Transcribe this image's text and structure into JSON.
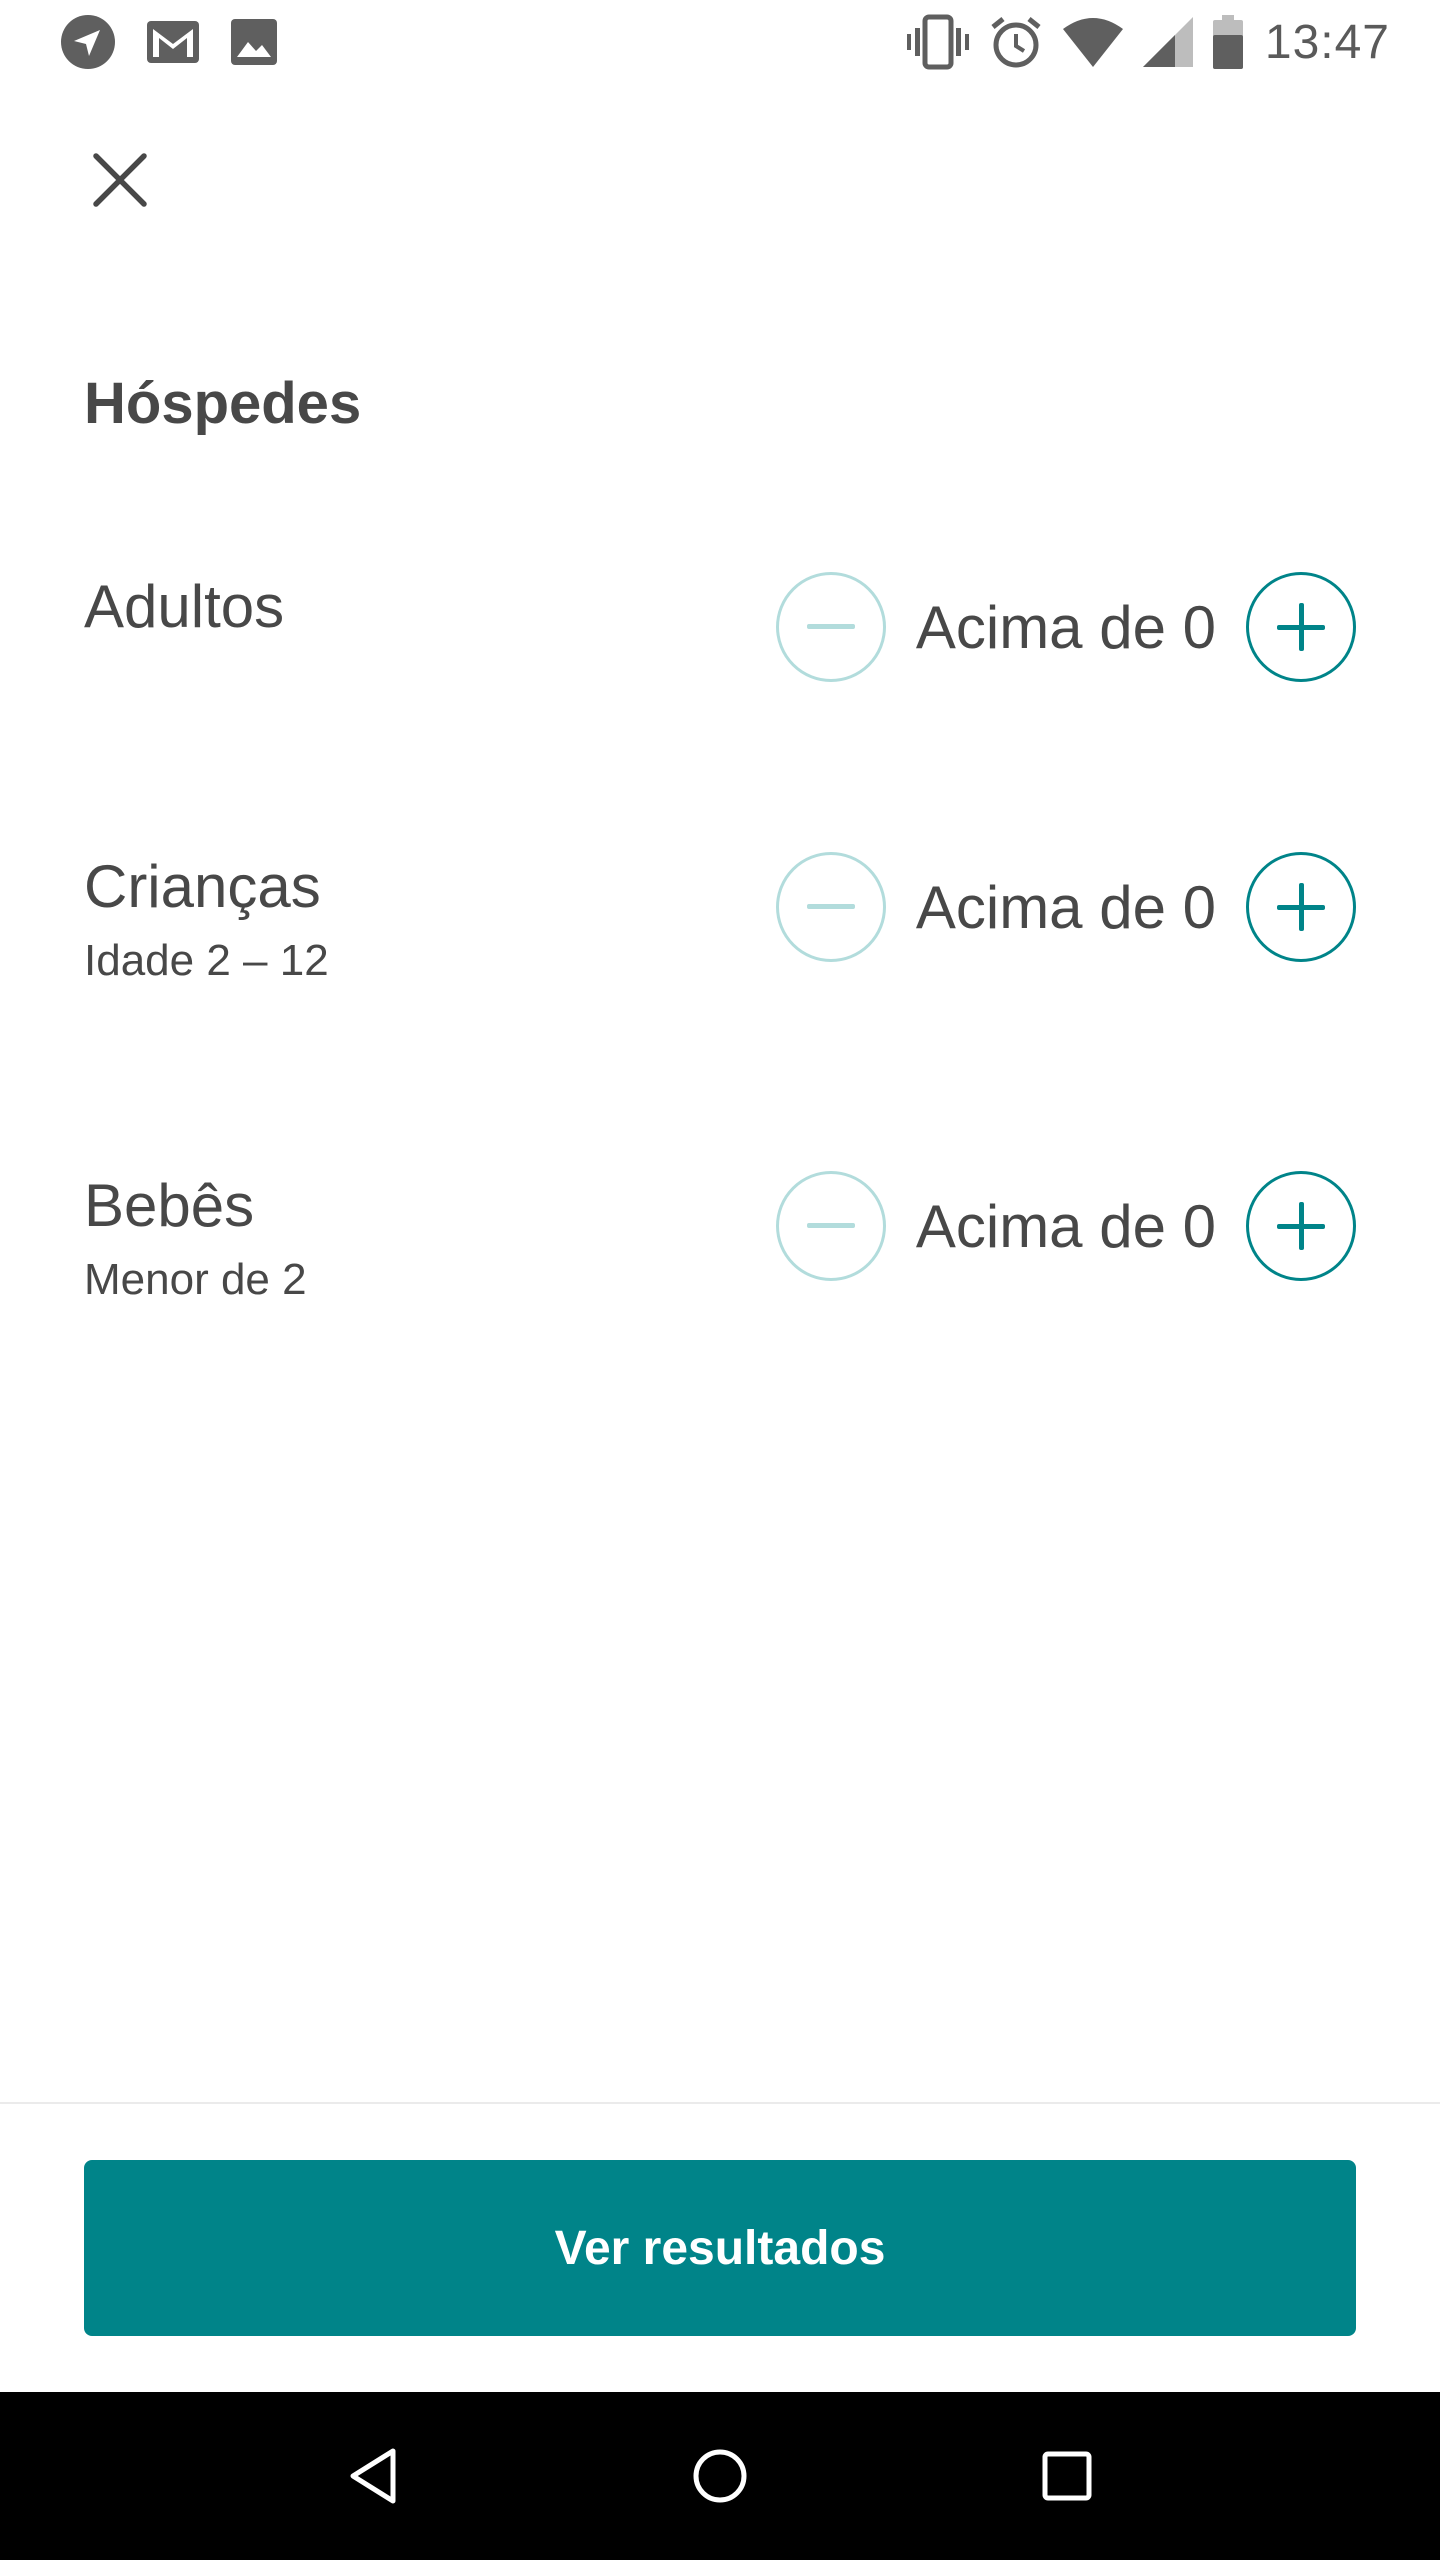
{
  "status_bar": {
    "time": "13:47",
    "left_icons": [
      "navigation-icon",
      "gmail-icon",
      "image-icon"
    ],
    "right_icons": [
      "vibrate-icon",
      "alarm-icon",
      "wifi-icon",
      "signal-icon",
      "battery-icon"
    ]
  },
  "header": {
    "close_icon": "close-icon",
    "title": "Hóspedes"
  },
  "guests": [
    {
      "label": "Adultos",
      "sublabel": "",
      "value": "Acima de 0"
    },
    {
      "label": "Crianças",
      "sublabel": "Idade 2 – 12",
      "value": "Acima de 0"
    },
    {
      "label": "Bebês",
      "sublabel": "Menor de 2",
      "value": "Acima de 0"
    }
  ],
  "footer": {
    "submit_label": "Ver resultados"
  },
  "colors": {
    "accent": "#008489",
    "accent_disabled": "#b2dcdc",
    "text": "#484848"
  },
  "nav_bar": {
    "icons": [
      "back-icon",
      "home-icon",
      "recents-icon"
    ]
  }
}
